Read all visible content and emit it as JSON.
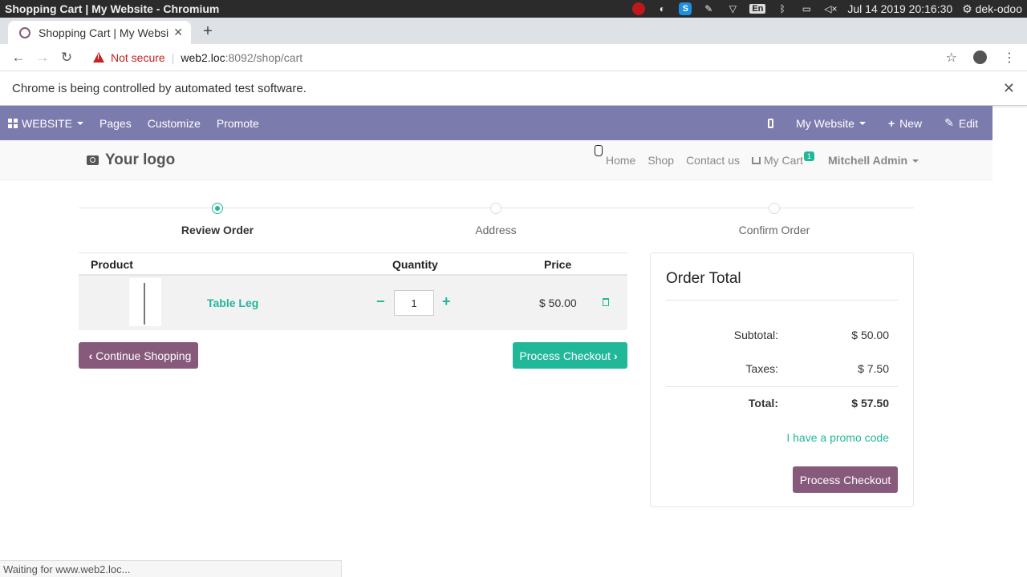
{
  "os": {
    "window_title": "Shopping Cart | My Website - Chromium",
    "keyboard": "En",
    "datetime": "Jul 14 2019 20:16:30",
    "user": "dek-odoo"
  },
  "browser": {
    "tab_title": "Shopping Cart | My Websi",
    "not_secure": "Not secure",
    "url_host": "web2.loc",
    "url_rest": ":8092/shop/cart",
    "infobar_text": "Chrome is being controlled by automated test software.",
    "status_text": "Waiting for www.web2.loc..."
  },
  "admin_bar": {
    "website_label": "WEBSITE",
    "pages_label": "Pages",
    "customize_label": "Customize",
    "promote_label": "Promote",
    "my_website_label": "My Website",
    "new_label": "New",
    "edit_label": "Edit"
  },
  "site": {
    "logo_text": "Your logo",
    "nav": {
      "home": "Home",
      "shop": "Shop",
      "contact": "Contact us",
      "cart": "My Cart",
      "cart_count": "1",
      "user": "Mitchell Admin"
    }
  },
  "wizard": {
    "steps": [
      "Review Order",
      "Address",
      "Confirm Order"
    ]
  },
  "cart": {
    "headers": {
      "product": "Product",
      "quantity": "Quantity",
      "price": "Price"
    },
    "item": {
      "name": "Table Leg",
      "quantity": "1",
      "price": "$ 50.00"
    },
    "continue_label": "Continue Shopping",
    "process_label": "Process Checkout"
  },
  "order_total": {
    "title": "Order Total",
    "subtotal_label": "Subtotal:",
    "subtotal": "$ 50.00",
    "taxes_label": "Taxes:",
    "taxes": "$ 7.50",
    "total_label": "Total:",
    "total": "$ 57.50",
    "promo_label": "I have a promo code",
    "checkout_label": "Process Checkout"
  },
  "colors": {
    "admin_bar": "#7c7bad",
    "primary": "#875a7b",
    "accent": "#21b799",
    "warning": "#c5221f"
  }
}
